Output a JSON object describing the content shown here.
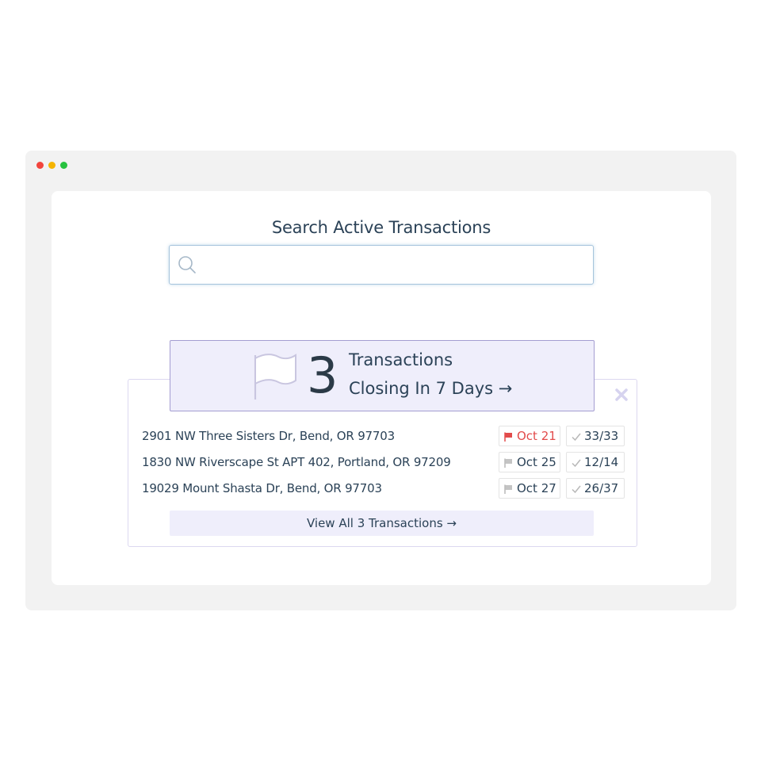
{
  "search": {
    "title": "Search Active Transactions",
    "value": "",
    "placeholder": ""
  },
  "summary": {
    "count": "3",
    "line1": "Transactions",
    "line2": "Closing In 7 Days →"
  },
  "transactions": [
    {
      "address": "2901 NW Three Sisters Dr, Bend, OR 97703",
      "date": "Oct 21",
      "date_alert": true,
      "tasks": "33/33"
    },
    {
      "address": "1830 NW Riverscape St APT 402, Portland, OR 97209",
      "date": "Oct 25",
      "date_alert": false,
      "tasks": "12/14"
    },
    {
      "address": "19029 Mount Shasta Dr, Bend, OR 97703",
      "date": "Oct 27",
      "date_alert": false,
      "tasks": "26/37"
    }
  ],
  "view_all": "View All 3 Transactions →",
  "icons": {
    "search": "search-icon",
    "close": "close-icon",
    "flag": "flag-icon",
    "check": "check-icon"
  },
  "colors": {
    "accent": "#efeefb",
    "accent_border": "#a49dd1",
    "alert": "#e24b4b",
    "text": "#2b4257"
  }
}
